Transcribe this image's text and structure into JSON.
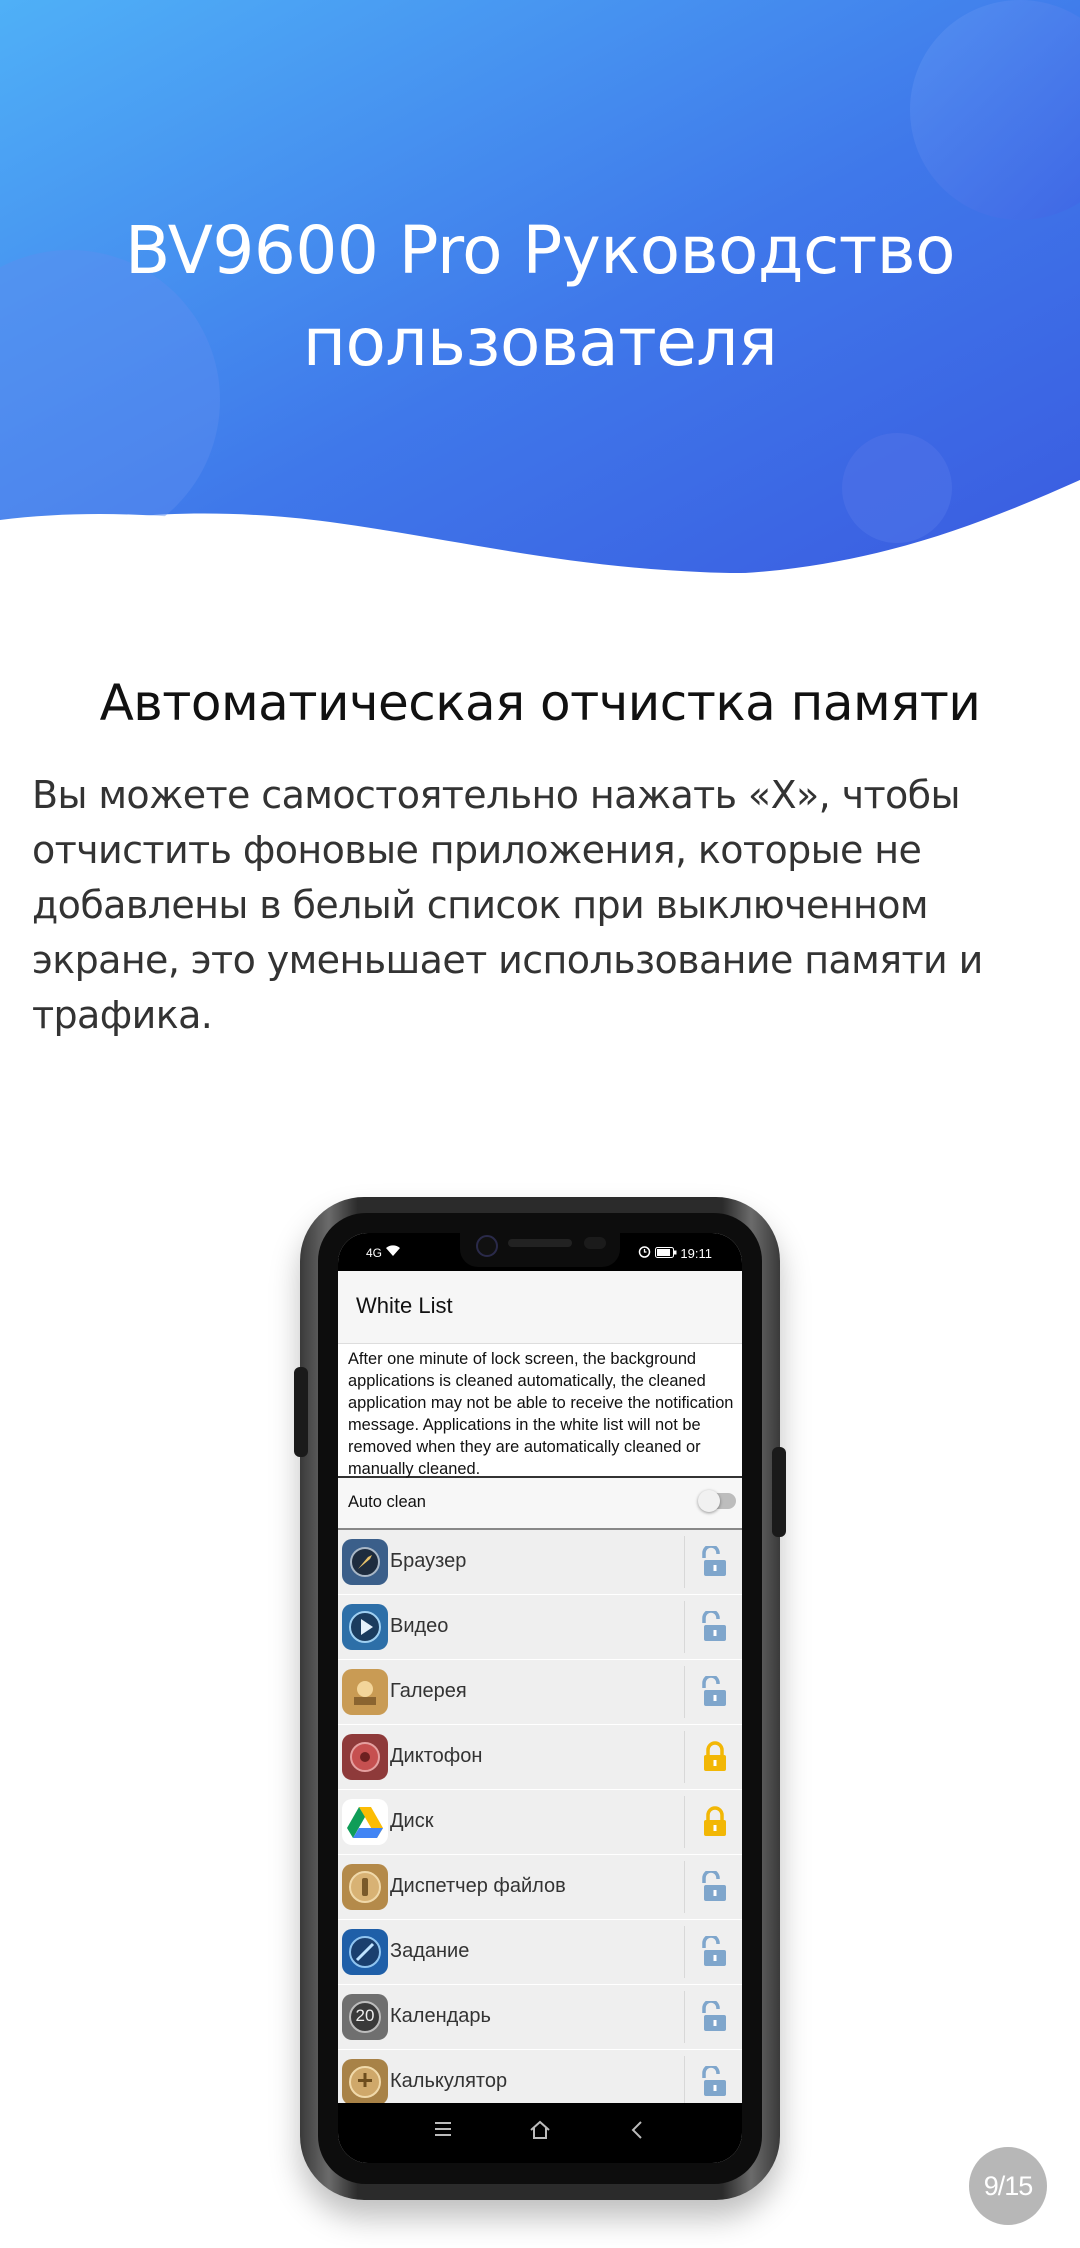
{
  "header": {
    "title_line1": "BV9600 Pro Руководство",
    "title_line2": "пользователя"
  },
  "section": {
    "title": "Автоматическая отчистка памяти",
    "body": "Вы можете самостоятельно нажать «X», чтобы отчистить фоновые приложения, которые не добавлены в белый список при выключенном экране, это уменьшает использование памяти и трафика."
  },
  "phone": {
    "status": {
      "signal": "4G",
      "time": "19:11"
    },
    "screen_title": "White List",
    "description": "After one minute of lock screen, the background applications is cleaned automatically, the cleaned application may not be able to receive the notification message. Applications in the white list will not be removed when they are automatically cleaned or manually cleaned.",
    "auto_clean": {
      "label": "Auto clean",
      "enabled": false
    },
    "apps": [
      {
        "name": "Браузер",
        "icon": "browser-icon",
        "locked": false
      },
      {
        "name": "Видео",
        "icon": "video-icon",
        "locked": false
      },
      {
        "name": "Галерея",
        "icon": "gallery-icon",
        "locked": false
      },
      {
        "name": "Диктофон",
        "icon": "recorder-icon",
        "locked": true
      },
      {
        "name": "Диск",
        "icon": "drive-icon",
        "locked": true
      },
      {
        "name": "Диспетчер файлов",
        "icon": "file-manager-icon",
        "locked": false
      },
      {
        "name": "Задание",
        "icon": "task-icon",
        "locked": false
      },
      {
        "name": "Календарь",
        "icon": "calendar-icon",
        "calendar_day": "20",
        "locked": false
      },
      {
        "name": "Калькулятор",
        "icon": "calculator-icon",
        "locked": false
      }
    ],
    "nav": {
      "menu": "☰",
      "home": "⌂",
      "back": "<"
    }
  },
  "colors": {
    "header_blue_light": "#4aa8f5",
    "header_blue_dark": "#3a5fe0",
    "lock_locked": "#f2b705",
    "lock_unlocked": "#7fa6cc"
  },
  "page_indicator": "9/15"
}
